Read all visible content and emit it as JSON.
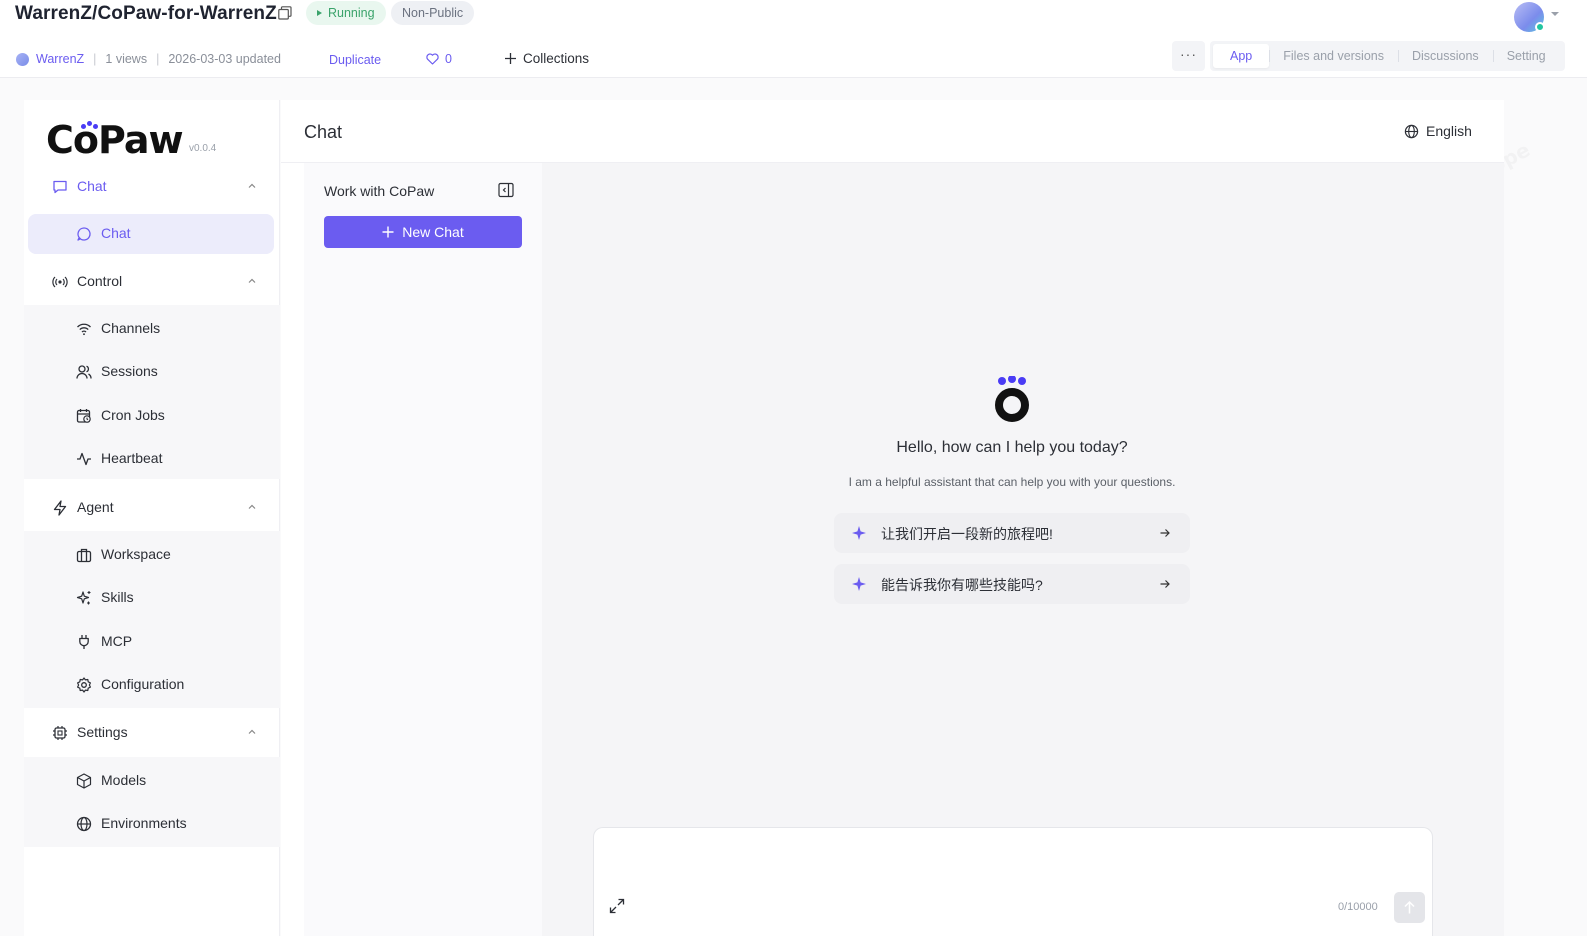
{
  "header": {
    "repo_title": "WarrenZ/CoPaw-for-WarrenZ",
    "status_running": "Running",
    "visibility": "Non-Public",
    "author": "WarrenZ",
    "views": "1 views",
    "updated": "2026-03-03 updated",
    "duplicate_label": "Duplicate",
    "likes": "0",
    "collections_label": "Collections",
    "more_label": "···",
    "tabs": [
      {
        "label": "App",
        "active": true
      },
      {
        "label": "Files and versions",
        "active": false
      },
      {
        "label": "Discussions",
        "active": false
      },
      {
        "label": "Setting",
        "active": false
      }
    ]
  },
  "sidebar": {
    "logo_text": "CoPaw",
    "version": "v0.0.4",
    "groups": [
      {
        "label": "Chat",
        "icon": "message-square-icon",
        "items": [
          {
            "label": "Chat",
            "icon": "message-circle-icon",
            "active": true
          }
        ]
      },
      {
        "label": "Control",
        "icon": "radio-icon",
        "items": [
          {
            "label": "Channels",
            "icon": "wifi-icon"
          },
          {
            "label": "Sessions",
            "icon": "users-icon"
          },
          {
            "label": "Cron Jobs",
            "icon": "calendar-clock-icon"
          },
          {
            "label": "Heartbeat",
            "icon": "activity-icon"
          }
        ]
      },
      {
        "label": "Agent",
        "icon": "zap-icon",
        "items": [
          {
            "label": "Workspace",
            "icon": "briefcase-icon"
          },
          {
            "label": "Skills",
            "icon": "sparkles-icon"
          },
          {
            "label": "MCP",
            "icon": "plug-icon"
          },
          {
            "label": "Configuration",
            "icon": "settings-icon"
          }
        ]
      },
      {
        "label": "Settings",
        "icon": "cpu-icon",
        "items": [
          {
            "label": "Models",
            "icon": "box-icon"
          },
          {
            "label": "Environments",
            "icon": "globe-icon"
          }
        ]
      }
    ]
  },
  "main": {
    "title": "Chat",
    "language": "English",
    "chat_list_title": "Work with CoPaw",
    "new_chat_label": "New Chat",
    "greeting": "Hello, how can I help you today?",
    "subtitle": "I am a helpful assistant that can help you with your questions.",
    "prompts": [
      "让我们开启一段新的旅程吧!",
      "能告诉我你有哪些技能吗?"
    ],
    "input_placeholder": "",
    "char_counter": "0/10000"
  },
  "colors": {
    "accent": "#6b5cf0",
    "running_green": "#3ba36b",
    "paw_blue": "#4a3cf5"
  }
}
